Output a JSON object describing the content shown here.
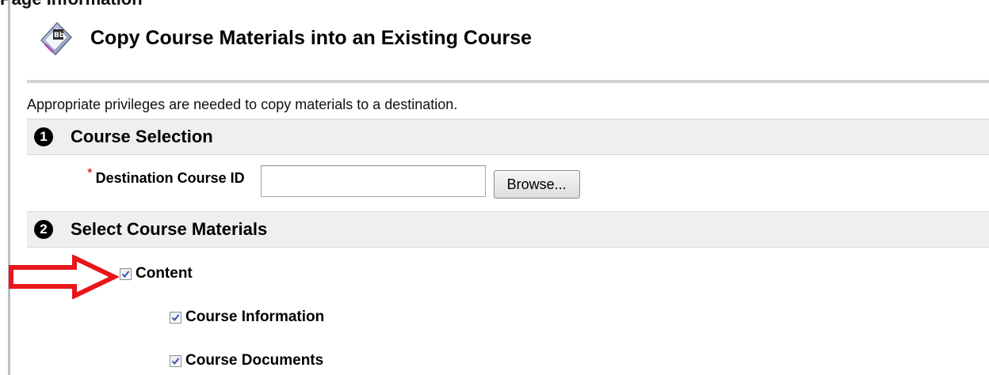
{
  "header": {
    "clipped_text": "Page Information",
    "title": "Copy Course Materials into an Existing Course",
    "title_icon": "blackboard-course-icon"
  },
  "intro_text": "Appropriate privileges are needed to copy materials to a destination.",
  "steps": [
    {
      "number": "1",
      "title": "Course Selection"
    },
    {
      "number": "2",
      "title": "Select Course Materials"
    }
  ],
  "course_selection": {
    "required_marker": "*",
    "label": "Destination Course ID",
    "input_value": "",
    "browse_label": "Browse..."
  },
  "materials": [
    {
      "label": "Content",
      "checked": true
    },
    {
      "label": "Course Information",
      "checked": true
    },
    {
      "label": "Course Documents",
      "checked": true
    }
  ],
  "annotation": {
    "arrow_color": "#e8161b"
  },
  "colors": {
    "step_bar_bg": "#efefef",
    "required_star": "#cc0000"
  }
}
